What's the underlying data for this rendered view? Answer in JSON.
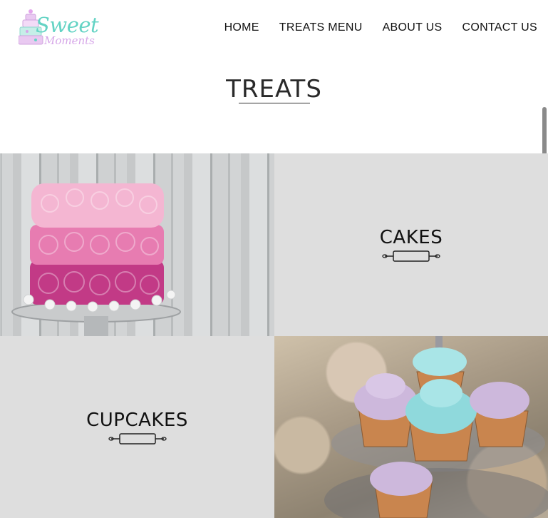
{
  "brand": {
    "line1": "Sweet",
    "line2": "Moments"
  },
  "nav": {
    "items": [
      {
        "label": "HOME"
      },
      {
        "label": "TREATS MENU"
      },
      {
        "label": "ABOUT US"
      },
      {
        "label": "CONTACT US"
      }
    ]
  },
  "section": {
    "title": "TREATS"
  },
  "tiles": {
    "cakes": {
      "label": "CAKES",
      "icon": "rolling-pin-icon"
    },
    "cupcakes": {
      "label": "CUPCAKES",
      "icon": "rolling-pin-icon"
    }
  },
  "colors": {
    "logo_teal": "#63d3c4",
    "logo_lilac": "#d6a6e8",
    "tile_bg": "#dedede"
  }
}
